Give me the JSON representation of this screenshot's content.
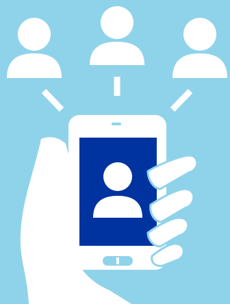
{
  "illustration": {
    "subject": "hand-holding-smartphone-contact-sharing",
    "colors": {
      "background": "#8fd3ea",
      "foreground": "#ffffff",
      "screen": "#0033a0"
    },
    "icons": [
      "person-icon-left",
      "person-icon-center",
      "person-icon-right",
      "signal-line-left",
      "signal-line-center",
      "signal-line-right",
      "smartphone",
      "hand-icon",
      "screen-person-icon"
    ]
  }
}
